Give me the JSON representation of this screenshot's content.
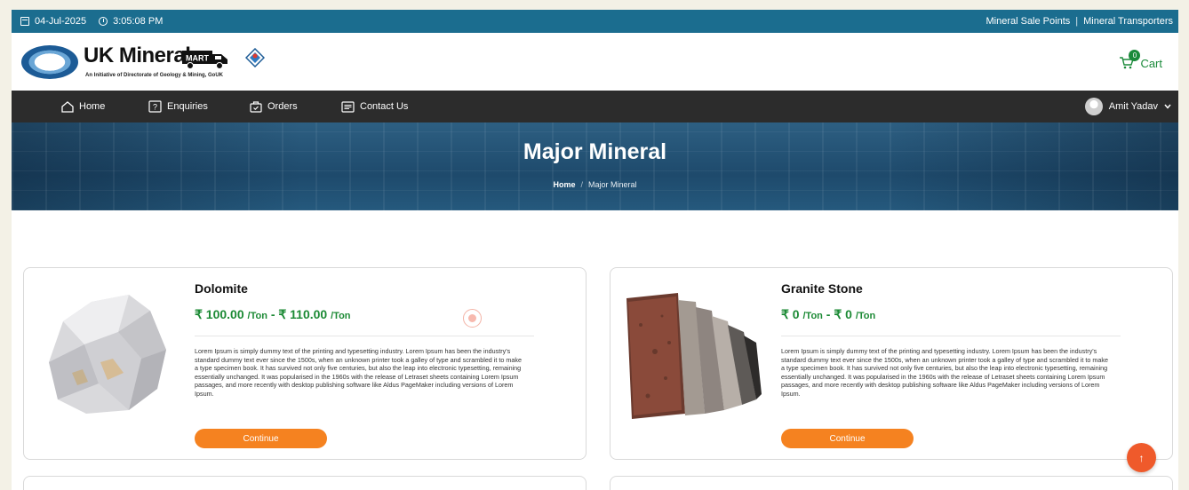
{
  "topbar": {
    "date": "04-Jul-2025",
    "time": "3:05:08 PM",
    "links": [
      {
        "label": "Mineral Sale Points"
      },
      {
        "label": "Mineral Transporters"
      }
    ],
    "separator": "|"
  },
  "header": {
    "logo_title": "UK Mineral",
    "logo_mart": "MART",
    "logo_subtitle": "An Initiative of Directorate of Geology & Mining, GoUK",
    "cart_label": "Cart",
    "cart_count": "0"
  },
  "nav": {
    "items": [
      {
        "label": "Home",
        "icon": "home-icon"
      },
      {
        "label": "Enquiries",
        "icon": "question-icon"
      },
      {
        "label": "Orders",
        "icon": "bag-icon"
      },
      {
        "label": "Contact Us",
        "icon": "message-icon"
      }
    ],
    "user_name": "Amit Yadav"
  },
  "hero": {
    "title": "Major Mineral",
    "breadcrumb": {
      "home": "Home",
      "separator": "/",
      "current": "Major Mineral"
    }
  },
  "products": [
    {
      "name": "Dolomite",
      "price_min": "₹ 100.00",
      "price_max": "₹ 110.00",
      "unit": "/Ton",
      "dash": "-",
      "description": "Lorem Ipsum is simply dummy text of the printing and typesetting industry. Lorem Ipsum has been the industry's standard dummy text ever since the 1500s, when an unknown printer took a galley of type and scrambled it to make a type specimen book. It has survived not only five centuries, but also the leap into electronic typesetting, remaining essentially unchanged. It was popularised in the 1960s with the release of Letraset sheets containing Lorem Ipsum passages, and more recently with desktop publishing software like Aldus PageMaker including versions of Lorem Ipsum.",
      "button": "Continue"
    },
    {
      "name": "Granite Stone",
      "price_min": "₹ 0",
      "price_max": "₹ 0",
      "unit": "/Ton",
      "dash": "-",
      "description": "Lorem Ipsum is simply dummy text of the printing and typesetting industry. Lorem Ipsum has been the industry's standard dummy text ever since the 1500s, when an unknown printer took a galley of type and scrambled it to make a type specimen book. It has survived not only five centuries, but also the leap into electronic typesetting, remaining essentially unchanged. It was popularised in the 1960s with the release of Letraset sheets containing Lorem Ipsum passages, and more recently with desktop publishing software like Aldus PageMaker including versions of Lorem Ipsum.",
      "button": "Continue"
    }
  ],
  "scroll_top_glyph": "↑",
  "colors": {
    "topbar": "#1b6d8f",
    "navbar": "#2c2c2c",
    "price_green": "#1c8a35",
    "button_orange": "#f58220",
    "scroll_top": "#ef5a2b"
  }
}
